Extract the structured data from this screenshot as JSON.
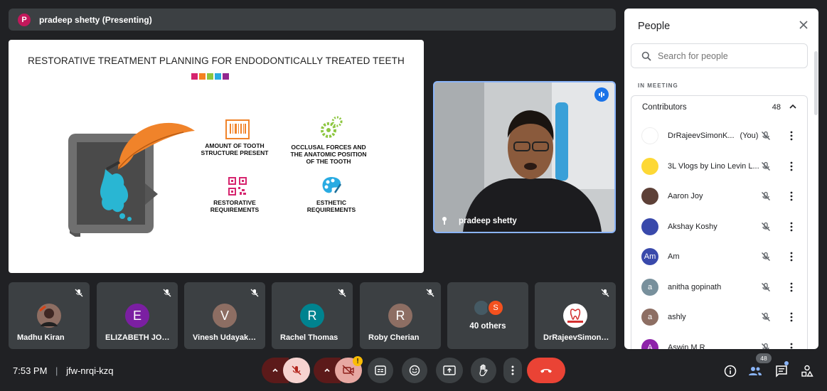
{
  "presenter": {
    "initial": "P",
    "label": "pradeep shetty (Presenting)"
  },
  "slide": {
    "title": "RESTORATIVE TREATMENT PLANNING FOR ENDODONTICALLY TREATED TEETH",
    "swatch_colors": [
      "#d6246e",
      "#f58220",
      "#8cc63f",
      "#29abe2",
      "#92278f"
    ],
    "items": [
      {
        "line1": "AMOUNT OF TOOTH",
        "line2": "STRUCTURE PRESENT",
        "line3": ""
      },
      {
        "line1": "OCCLUSAL FORCES AND",
        "line2": "THE ANATOMIC POSITION",
        "line3": "OF THE TOOTH"
      },
      {
        "line1": "RESTORATIVE",
        "line2": "REQUIREMENTS",
        "line3": ""
      },
      {
        "line1": "ESTHETIC",
        "line2": "REQUIREMENTS",
        "line3": ""
      }
    ]
  },
  "main_video": {
    "name": "pradeep shetty"
  },
  "tiles": [
    {
      "name": "Madhu Kiran",
      "initial": "",
      "color": "#6d4c41"
    },
    {
      "name": "ELIZABETH JOSEPH",
      "initial": "E",
      "color": "#7b1fa2"
    },
    {
      "name": "Vinesh Udayakumar",
      "initial": "V",
      "color": "#8d6e63"
    },
    {
      "name": "Rachel Thomas",
      "initial": "R",
      "color": "#00838f"
    },
    {
      "name": "Roby Cherian",
      "initial": "R",
      "color": "#8d6e63"
    },
    {
      "name": "40 others",
      "initial": "S",
      "color": "#f4511e"
    },
    {
      "name": "DrRajeevSimonKoshy",
      "initial": "",
      "color": "#ffffff"
    }
  ],
  "bottom": {
    "time": "7:53 PM",
    "separator": "|",
    "meeting_code": "jfw-nrqi-kzq",
    "people_count": "48"
  },
  "panel": {
    "title": "People",
    "search_placeholder": "Search for people",
    "section_label": "IN MEETING",
    "group_label": "Contributors",
    "group_count": "48",
    "people": [
      {
        "name": "DrRajeevSimonK...",
        "suffix": "(You)",
        "initial": "",
        "color": "#ffffff"
      },
      {
        "name": "3L Vlogs by Lino Levin L...",
        "suffix": "",
        "initial": "",
        "color": "#fdd835"
      },
      {
        "name": "Aaron Joy",
        "suffix": "",
        "initial": "",
        "color": "#5d4037"
      },
      {
        "name": "Akshay Koshy",
        "suffix": "",
        "initial": "",
        "color": "#3949ab"
      },
      {
        "name": "Am",
        "suffix": "",
        "initial": "Am",
        "color": "#3949ab"
      },
      {
        "name": "anitha gopinath",
        "suffix": "",
        "initial": "a",
        "color": "#78909c"
      },
      {
        "name": "ashly",
        "suffix": "",
        "initial": "a",
        "color": "#8d6e63"
      },
      {
        "name": "Aswin M R",
        "suffix": "",
        "initial": "A",
        "color": "#8e24aa"
      }
    ]
  }
}
